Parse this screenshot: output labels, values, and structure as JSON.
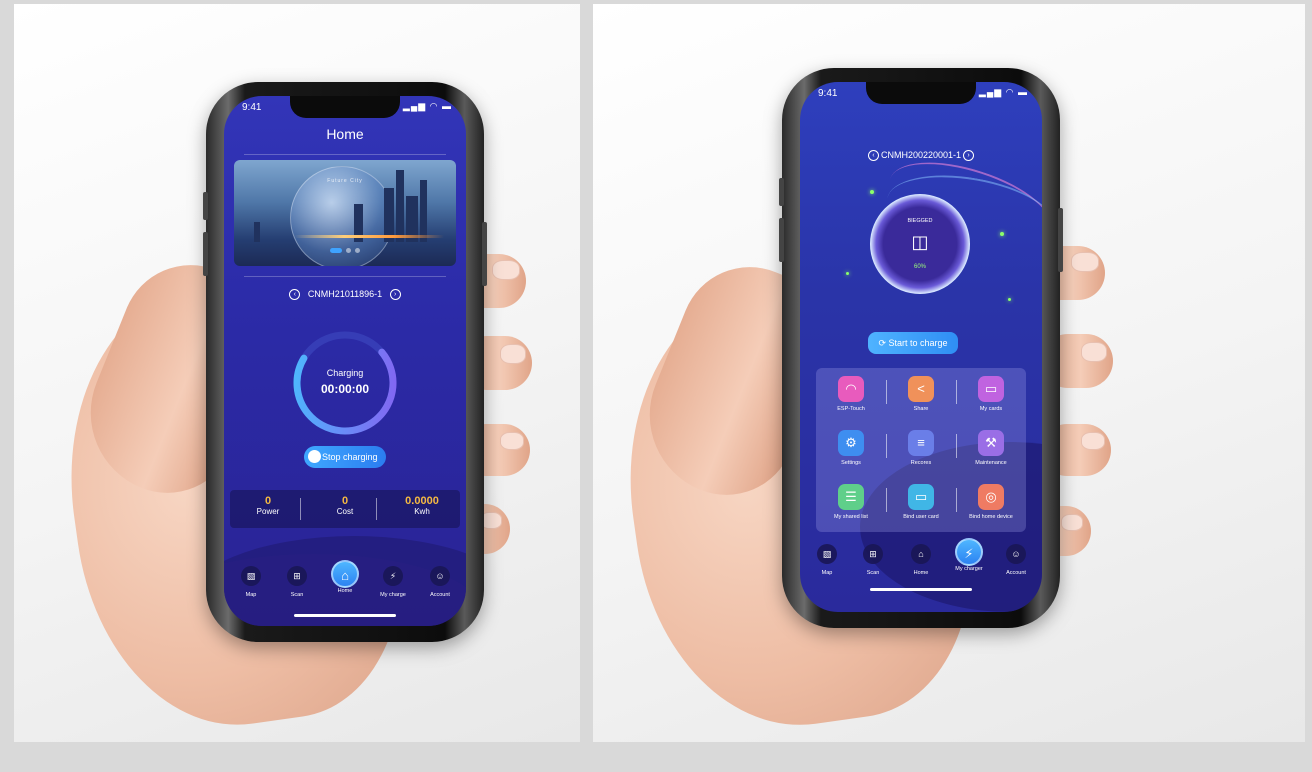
{
  "left_phone": {
    "status_time": "9:41",
    "status_icons": "▂▄▆ ◠ ▬",
    "title": "Home",
    "banner_caption": "Future City",
    "device_id": "CNMH21011896-1",
    "charging_label": "Charging",
    "timer": "00:00:00",
    "stop_button": "Stop charging",
    "stats": [
      {
        "value": "0",
        "label": "Power"
      },
      {
        "value": "0",
        "label": "Cost"
      },
      {
        "value": "0.0000",
        "label": "Kwh"
      }
    ],
    "tabs": [
      {
        "label": "Map",
        "icon": "map-icon",
        "glyph": "▧"
      },
      {
        "label": "Scan",
        "icon": "scan-icon",
        "glyph": "⊞"
      },
      {
        "label": "Home",
        "icon": "home-icon",
        "glyph": "⌂"
      },
      {
        "label": "My charge",
        "icon": "charger-icon",
        "glyph": "⚡"
      },
      {
        "label": "Account",
        "icon": "account-icon",
        "glyph": "☺"
      }
    ]
  },
  "right_phone": {
    "status_time": "9:41",
    "status_icons": "▂▄▆ ◠ ▬",
    "device_id": "CNMH200220001-1",
    "ring_title": "BIEGGED",
    "ring_percent": "60%",
    "start_button": "Start to charge",
    "grid": [
      {
        "label": "ESP-Touch",
        "icon": "wifi-icon",
        "glyph": "◠",
        "color": "#e85bbd"
      },
      {
        "label": "Share",
        "icon": "share-icon",
        "glyph": "<",
        "color": "#f0915a"
      },
      {
        "label": "My cards",
        "icon": "card-icon",
        "glyph": "▭",
        "color": "#c063e0"
      },
      {
        "label": "Settings",
        "icon": "gear-icon",
        "glyph": "⚙",
        "color": "#3e8ef0"
      },
      {
        "label": "Recores",
        "icon": "records-icon",
        "glyph": "≡",
        "color": "#6a7ee8"
      },
      {
        "label": "Maintenance",
        "icon": "wrench-icon",
        "glyph": "⚒",
        "color": "#9a6ee6"
      },
      {
        "label": "My shared list",
        "icon": "list-icon",
        "glyph": "☰",
        "color": "#5fcf8a"
      },
      {
        "label": "Bind user card",
        "icon": "bind-card-icon",
        "glyph": "▭",
        "color": "#40b6e6"
      },
      {
        "label": "Bind home device",
        "icon": "bind-device-icon",
        "glyph": "◎",
        "color": "#ef7b63"
      }
    ],
    "tabs": [
      {
        "label": "Map",
        "icon": "map-icon",
        "glyph": "▧"
      },
      {
        "label": "Scan",
        "icon": "scan-icon",
        "glyph": "⊞"
      },
      {
        "label": "Home",
        "icon": "home-icon",
        "glyph": "⌂"
      },
      {
        "label": "My charger",
        "icon": "charger-icon",
        "glyph": "⚡"
      },
      {
        "label": "Account",
        "icon": "account-icon",
        "glyph": "☺"
      }
    ]
  }
}
